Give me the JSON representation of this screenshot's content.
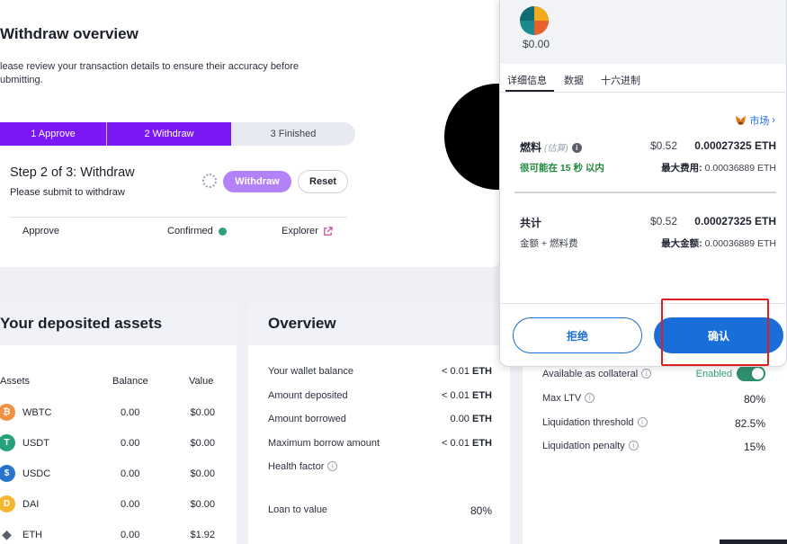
{
  "withdraw": {
    "title": "Withdraw overview",
    "review_text": "lease review your transaction details to ensure their accuracy before ubmitting.",
    "steps": [
      {
        "label": "1 Approve"
      },
      {
        "label": "2 Withdraw"
      },
      {
        "label": "3 Finished"
      }
    ],
    "step_heading": "Step 2 of 3: Withdraw",
    "step_sub": "Please submit to withdraw",
    "withdraw_button": "Withdraw",
    "reset_button": "Reset",
    "status_approve": "Approve",
    "status_confirmed": "Confirmed",
    "status_explorer": "Explorer"
  },
  "assets": {
    "title": "Your deposited assets",
    "columns": {
      "assets": "Assets",
      "balance": "Balance",
      "value": "Value"
    },
    "rows": [
      {
        "name": "WBTC",
        "balance": "0.00",
        "value": "$0.00",
        "icon": "wbtc-icon",
        "color": "#f09242"
      },
      {
        "name": "USDT",
        "balance": "0.00",
        "value": "$0.00",
        "icon": "usdt-icon",
        "color": "#26a17b"
      },
      {
        "name": "USDC",
        "balance": "0.00",
        "value": "$0.00",
        "icon": "usdc-icon",
        "color": "#2775ca"
      },
      {
        "name": "DAI",
        "balance": "0.00",
        "value": "$0.00",
        "icon": "dai-icon",
        "color": "#f4b731"
      },
      {
        "name": "ETH",
        "balance": "0.00",
        "value": "$1.92",
        "icon": "eth-icon",
        "color": "#5a5f6b"
      }
    ]
  },
  "overview": {
    "title": "Overview",
    "rows": [
      {
        "label": "Your wallet balance",
        "value": "< 0.01",
        "unit": "ETH"
      },
      {
        "label": "Amount deposited",
        "value": "< 0.01",
        "unit": "ETH"
      },
      {
        "label": "Amount borrowed",
        "value": "0.00",
        "unit": "ETH"
      },
      {
        "label": "Maximum borrow amount",
        "value": "< 0.01",
        "unit": "ETH"
      },
      {
        "label": "Health factor",
        "value": "",
        "unit": ""
      }
    ],
    "ltv_label": "Loan to value",
    "ltv_value": "80%"
  },
  "risk": {
    "collateral_label": "Available as collateral",
    "collateral_status": "Enabled",
    "rows": [
      {
        "label": "Max LTV",
        "value": "80%"
      },
      {
        "label": "Liquidation threshold",
        "value": "82.5%"
      },
      {
        "label": "Liquidation penalty",
        "value": "15%"
      }
    ]
  },
  "metamask": {
    "balance": "$0.00",
    "tabs": [
      "详细信息",
      "数据",
      "十六进制"
    ],
    "market_link": "市场",
    "gas_label": "燃料",
    "gas_est": "(估算)",
    "gas_usd": "$0.52",
    "gas_eth": "0.00027325 ETH",
    "gas_time": "很可能在 15 秒 以内",
    "max_fee_label": "最大费用:",
    "max_fee_value": "0.00036889 ETH",
    "total_label": "共计",
    "total_usd": "$0.52",
    "total_eth": "0.00027325 ETH",
    "total_sub": "金额 + 燃料费",
    "max_amount_label": "最大金额:",
    "max_amount_value": "0.00036889 ETH",
    "reject_button": "拒绝",
    "confirm_button": "确认"
  },
  "colors": {
    "stepper_active": "#7b19f5",
    "withdraw_button": "#b382f7",
    "metamask_blue": "#1a6ed8",
    "enabled_green": "#2f9f7f",
    "highlight_red": "#e21d1d"
  }
}
